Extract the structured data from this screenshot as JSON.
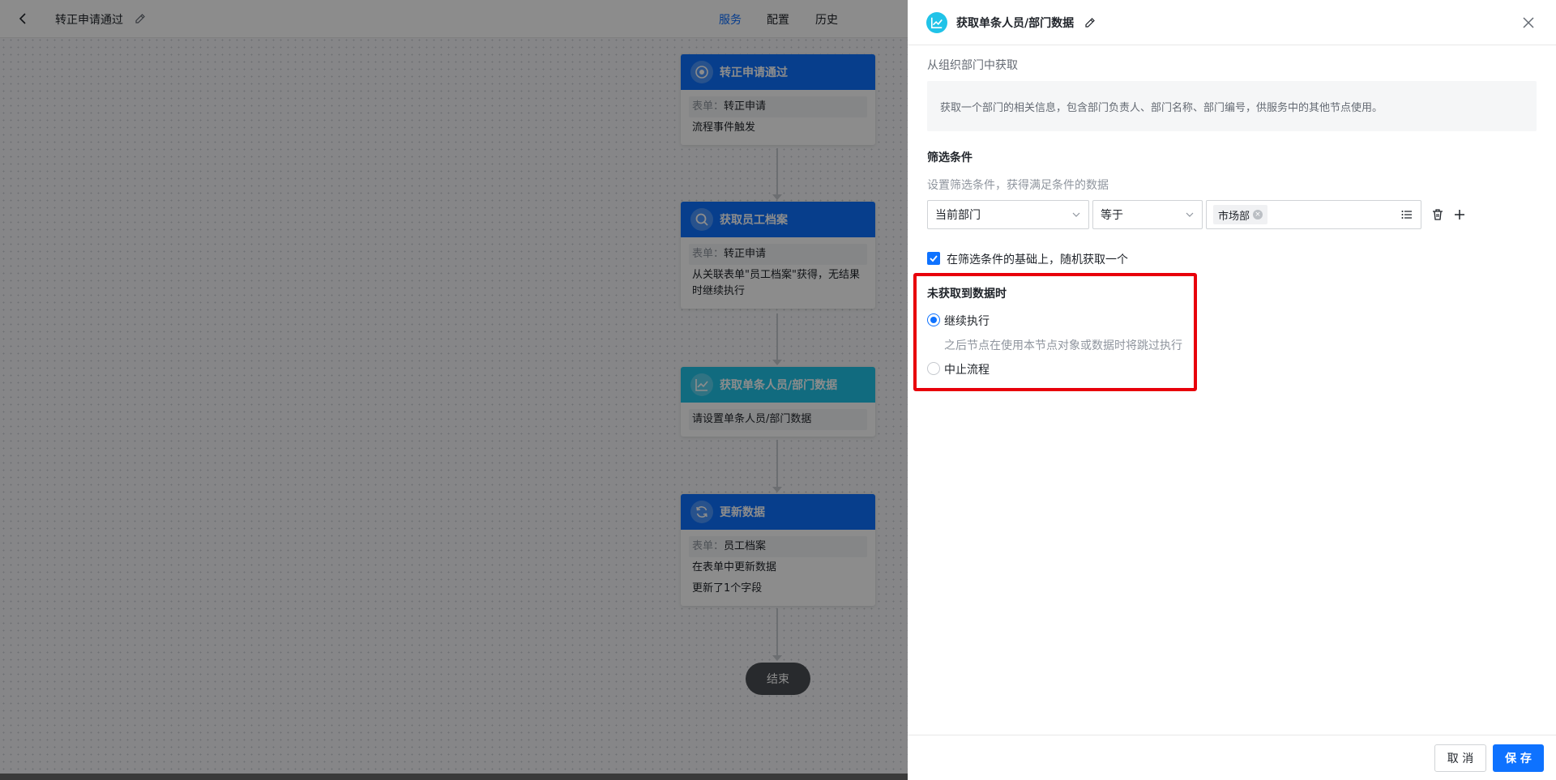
{
  "topbar": {
    "title": "转正申请通过",
    "nav": [
      "服务",
      "配置",
      "历史"
    ],
    "active_nav": "服务"
  },
  "flow": {
    "nodes": [
      {
        "title": "转正申请通过",
        "icon": "target-icon",
        "rows": [
          {
            "label": "表单：",
            "value": "转正申请"
          },
          {
            "label": "",
            "value": "流程事件触发"
          }
        ]
      },
      {
        "title": "获取员工档案",
        "icon": "search-icon",
        "rows": [
          {
            "label": "表单：",
            "value": "转正申请"
          },
          {
            "label": "",
            "value": "从关联表单\"员工档案\"获得，无结果时继续执行"
          }
        ]
      },
      {
        "title": "获取单条人员/部门数据",
        "icon": "chart-line-icon",
        "rows": [
          {
            "label": "",
            "value": "请设置单条人员/部门数据"
          }
        ]
      },
      {
        "title": "更新数据",
        "icon": "refresh-icon",
        "rows": [
          {
            "label": "表单：",
            "value": "员工档案"
          },
          {
            "label": "",
            "value": "在表单中更新数据"
          },
          {
            "label": "",
            "value": "更新了1个字段"
          }
        ]
      }
    ],
    "end_label": "结束"
  },
  "drawer": {
    "title": "获取单条人员/部门数据",
    "source": "从组织部门中获取",
    "description": "获取一个部门的相关信息，包含部门负责人、部门名称、部门编号，供服务中的其他节点使用。",
    "filter": {
      "title": "筛选条件",
      "hint": "设置筛选条件，获得满足条件的数据",
      "field": "当前部门",
      "operator": "等于",
      "value_tag": "市场部"
    },
    "random_checkbox": {
      "label": "在筛选条件的基础上，随机获取一个",
      "checked": true
    },
    "no_data": {
      "title": "未获取到数据时",
      "options": [
        {
          "label": "继续执行",
          "selected": true
        },
        {
          "label": "中止流程",
          "selected": false
        }
      ],
      "continue_hint": "之后节点在使用本节点对象或数据时将跳过执行"
    },
    "footer": {
      "cancel": "取 消",
      "save": "保 存"
    }
  },
  "colors": {
    "primary": "#0e72ff",
    "cyan": "#20c3e8",
    "highlight": "#e8000b"
  }
}
